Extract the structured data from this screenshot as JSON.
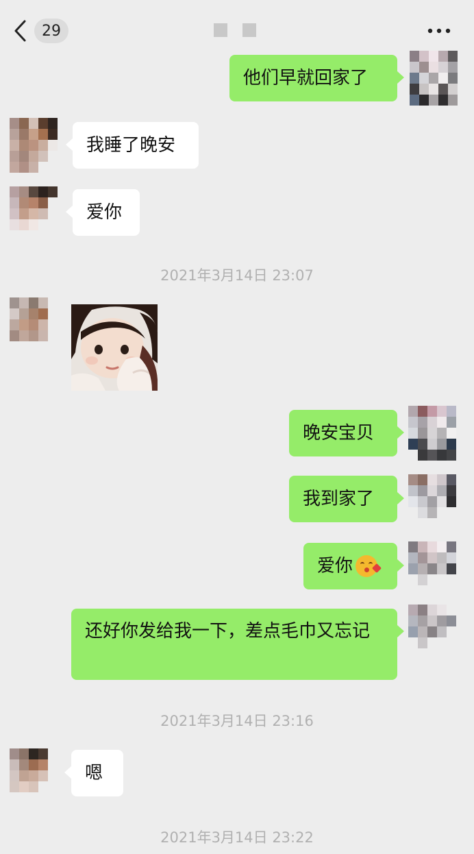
{
  "header": {
    "unread_count": "29",
    "back_icon": "chevron-left-icon",
    "more_icon": "ellipsis-icon"
  },
  "messages": [
    {
      "side": "out",
      "text": "他们早就回家了"
    },
    {
      "side": "in",
      "text": "我睡了晚安"
    },
    {
      "side": "in",
      "text": "爱你"
    },
    {
      "side": "in",
      "type": "image",
      "content": "child-photo"
    },
    {
      "side": "out",
      "text": "晚安宝贝"
    },
    {
      "side": "out",
      "text": "我到家了"
    },
    {
      "side": "out",
      "text": "爱你",
      "emoji": "kiss-face-emoji"
    },
    {
      "side": "out",
      "text": "还好你发给我一下，差点毛巾又忘记"
    },
    {
      "side": "in",
      "text": "嗯"
    }
  ],
  "timestamps": [
    "2021年3月14日 23:07",
    "2021年3月14日 23:16",
    "2021年3月14日 23:22"
  ],
  "colors": {
    "background": "#ededed",
    "outgoing_bubble": "#95ec69",
    "incoming_bubble": "#ffffff",
    "timestamp_text": "#b0b0b0"
  }
}
